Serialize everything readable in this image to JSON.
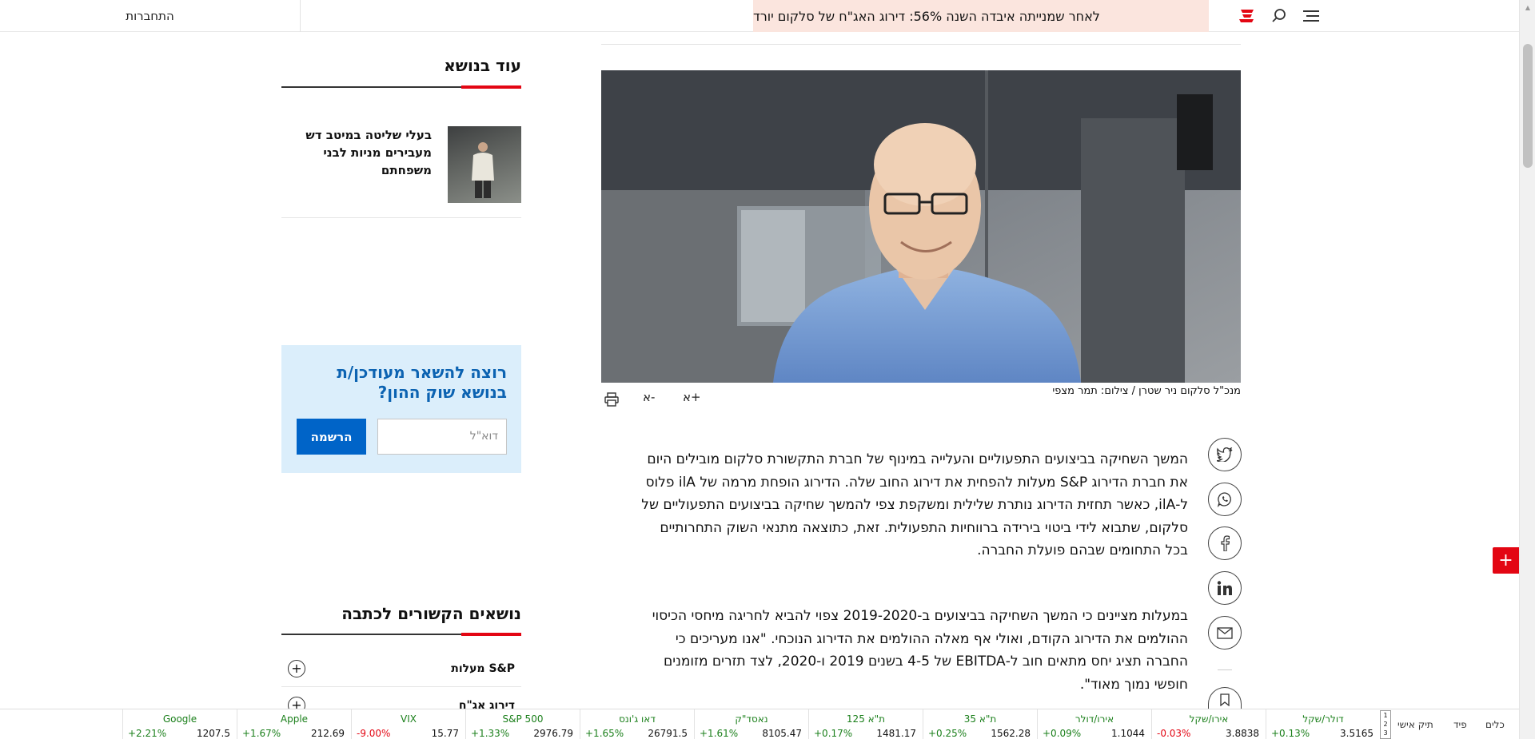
{
  "header": {
    "login_label": "התחברות",
    "headline": "לאחר שמנייתה איבדה השנה 56%: דירוג האג\"ח של סלקום יורד",
    "brand_color": "#e30613",
    "headline_bg": "#fbe5de"
  },
  "sidebar": {
    "more_title": "עוד בנושא",
    "related": [
      {
        "title": "בעלי שליטה במיטב דש מעבירים מניות לבני משפחתם"
      }
    ],
    "newsletter": {
      "title": "רוצה להשאר מעודכן/ת בנושא שוק ההון?",
      "email_placeholder": "דוא\"ל",
      "button_label": "הרשמה"
    },
    "topics_title": "נושאים הקשורים לכתבה",
    "topics": [
      "S&P מעלות",
      "דירוג אג\"ח"
    ]
  },
  "article": {
    "caption": "מנכ\"ל סלקום ניר שטרן / צילום: תמר מצפי",
    "tools": {
      "font_up": "א+",
      "font_down": "א-"
    },
    "paragraphs": [
      "המשך השחיקה בביצועים התפעוליים והעלייה במינוף של חברת התקשורת סלקום מובילים היום את חברת הדירוג S&P מעלות להפחית את דירוג החוב שלה. הדירוג הופחת מרמה של ilA פלוס ל-ilA, כאשר תחזית הדירוג נותרת שלילית ומשקפת צפי להמשך שחיקה בביצועים התפעוליים של סלקום, שתבוא לידי ביטוי בירידה ברווחיות התפעולית. זאת, כתוצאה מתנאי השוק התחרותיים בכל התחומים שבהם פועלת החברה.",
      "במעלות מציינים כי המשך השחיקה בביצועים ב-2019-2020 צפוי להביא לחריגה מיחסי הכיסוי ההולמים את הדירוג הקודם, ואולי אף מאלה ההולמים את הדירוג הנוכחי. \"אנו מעריכים כי החברה תציג יחס מתאים חוב ל-EBITDA של 4-5 בשנים 2019 ו-2020, לצד תזרים מזומנים חופשי נמוך מאוד\"."
    ],
    "share_icons": [
      "twitter-icon",
      "whatsapp-icon",
      "facebook-icon",
      "linkedin-icon",
      "email-icon",
      "bookmark-icon"
    ]
  },
  "ticker": {
    "tabs": [
      "כלים",
      "פיד",
      "תיק אישי"
    ],
    "pager": [
      "1",
      "2",
      "3"
    ],
    "up_color": "#1a7f1a",
    "down_color": "#e30613",
    "items": [
      {
        "name": "דולר/שקל",
        "pct": "+0.13%",
        "value": "3.5165",
        "dir": "up"
      },
      {
        "name": "אירו/שקל",
        "pct": "-0.03%",
        "value": "3.8838",
        "dir": "down"
      },
      {
        "name": "אירו/דולר",
        "pct": "+0.09%",
        "value": "1.1044",
        "dir": "up"
      },
      {
        "name": "ת\"א 35",
        "pct": "+0.25%",
        "value": "1562.28",
        "dir": "up"
      },
      {
        "name": "ת\"א 125",
        "pct": "+0.17%",
        "value": "1481.17",
        "dir": "up"
      },
      {
        "name": "נאסד\"ק",
        "pct": "+1.61%",
        "value": "8105.47",
        "dir": "up"
      },
      {
        "name": "דאו ג'ונס",
        "pct": "+1.65%",
        "value": "26791.5",
        "dir": "up"
      },
      {
        "name": "S&P 500",
        "pct": "+1.33%",
        "value": "2976.79",
        "dir": "up"
      },
      {
        "name": "VIX",
        "pct": "-9.00%",
        "value": "15.77",
        "dir": "down"
      },
      {
        "name": "Apple",
        "pct": "+1.67%",
        "value": "212.69",
        "dir": "up"
      },
      {
        "name": "Google",
        "pct": "+2.21%",
        "value": "1207.5",
        "dir": "up"
      }
    ]
  }
}
